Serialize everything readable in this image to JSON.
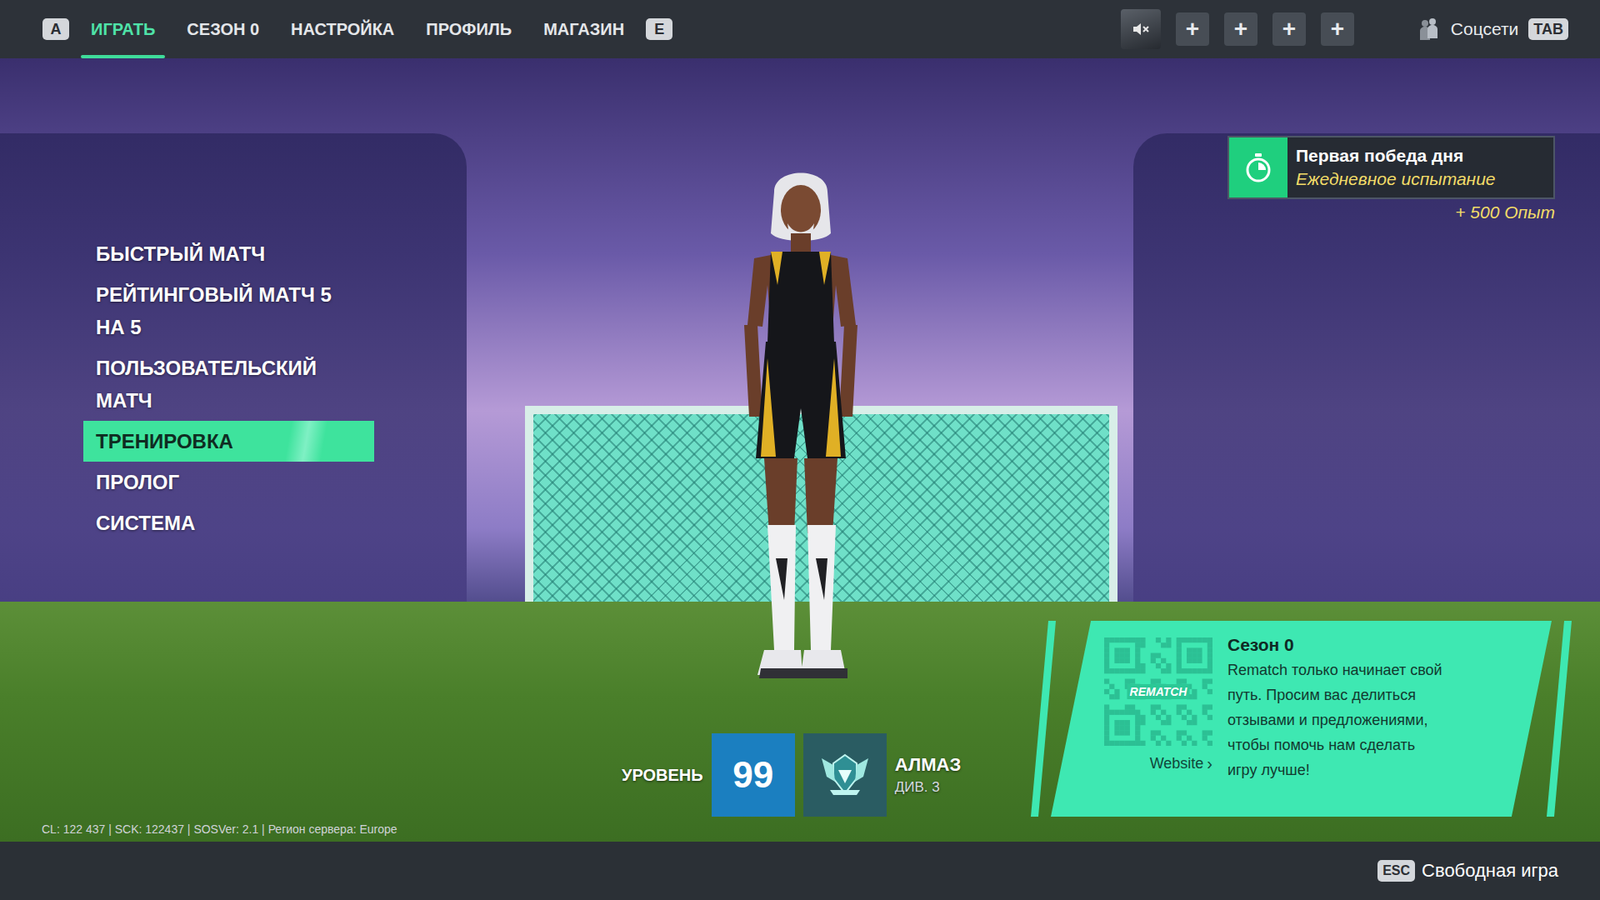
{
  "top_bar": {
    "key_left": "A",
    "tabs": [
      {
        "label": "ИГРАТЬ",
        "selected": true
      },
      {
        "label": "СЕЗОН 0",
        "selected": false
      },
      {
        "label": "НАСТРОЙКА",
        "selected": false
      },
      {
        "label": "ПРОФИЛЬ",
        "selected": false
      },
      {
        "label": "МАГАЗИН",
        "selected": false
      }
    ],
    "key_right": "E",
    "party": {
      "muted": true,
      "slots": [
        "+",
        "+",
        "+",
        "+"
      ]
    },
    "social": {
      "label": "Соцсети",
      "key": "TAB"
    }
  },
  "menu": {
    "items": [
      {
        "label": "БЫСТРЫЙ МАТЧ",
        "selected": false
      },
      {
        "label": "РЕЙТИНГОВЫЙ МАТЧ 5 НА 5",
        "selected": false
      },
      {
        "label": "ПОЛЬЗОВАТЕЛЬСКИЙ МАТЧ",
        "selected": false
      },
      {
        "label": "ТРЕНИРОВКА",
        "selected": true
      },
      {
        "label": "ПРОЛОГ",
        "selected": false
      },
      {
        "label": "СИСТЕМА",
        "selected": false
      }
    ]
  },
  "challenge": {
    "title": "Первая победа дня",
    "subtitle": "Ежедневное испытание",
    "reward": "+ 500 Опыт"
  },
  "player": {
    "level_label": "УРОВЕНЬ",
    "level": "99",
    "rank": "АЛМАЗ",
    "division": "ДИВ. 3"
  },
  "season_card": {
    "title": "Сезон 0",
    "text": "Rematch только начинает свой путь. Просим вас делиться отзывами и предложениями, чтобы помочь нам сделать игру лучше!",
    "qr_logo": "REMATCH",
    "link": "Website",
    "link_icon": "›"
  },
  "debug": "CL: 122 437 | SCK: 122437 | SOSVer: 2.1 | Регион сервера: Europe",
  "bottom_bar": {
    "key": "ESC",
    "label": "Свободная игра"
  }
}
